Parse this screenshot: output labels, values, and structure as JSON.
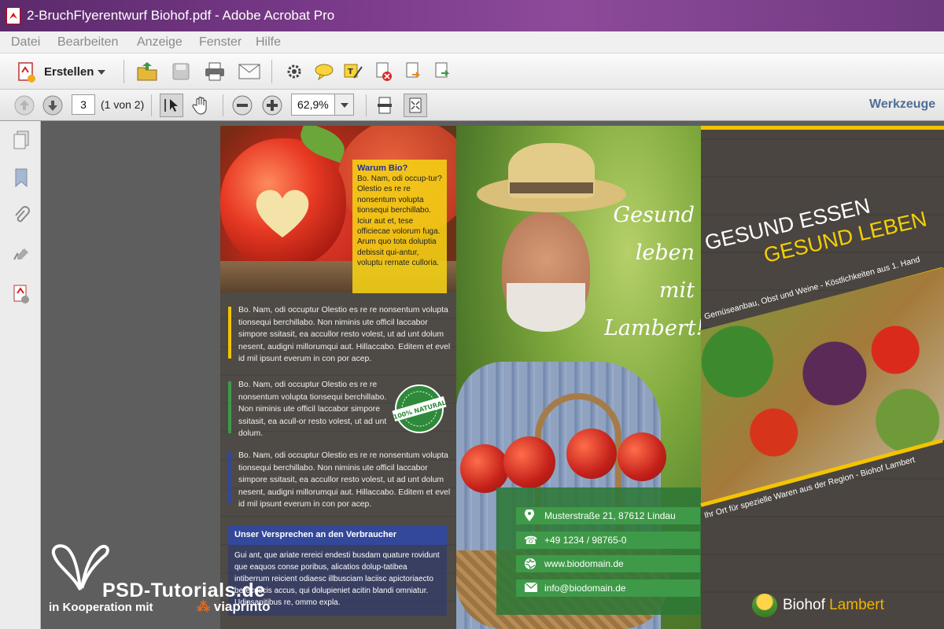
{
  "window": {
    "title": "2-BruchFlyerentwurf Biohof.pdf - Adobe Acrobat Pro"
  },
  "menu": [
    "Datei",
    "Bearbeiten",
    "Anzeige",
    "Fenster",
    "Hilfe"
  ],
  "toolbar": {
    "create_label": "Erstellen",
    "icons": [
      "open-icon",
      "save-icon",
      "print-icon",
      "email-icon",
      "settings-icon",
      "comment-icon",
      "sign-icon",
      "delete-page-icon",
      "export-icon",
      "share-icon"
    ]
  },
  "navigation": {
    "current_page": "3",
    "page_count": "(1 von 2)",
    "zoom": "62,9%",
    "tools_label": "Werkzeuge"
  },
  "side_panel": [
    "pages-icon",
    "bookmark-icon",
    "attachment-icon",
    "signature-icon",
    "document-properties-icon"
  ],
  "flyer": {
    "warum": {
      "title": "Warum Bio?",
      "text": "Bo. Nam, odi occup-tur? Olestio es re re nonsentum volupta tionsequi berchillabo. Iciur aut et, tese officiecae volorum fuga. Arum quo tota doluptia debissit qui-antur, voluptu rernate culloria."
    },
    "block1": "Bo. Nam, odi occuptur Olestio es re re nonsentum volupta tionsequi berchillabo. Non niminis ute officil laccabor simpore ssitasit, ea accullor resto volest, ut ad unt dolum nesent, audigni millorumqui aut. Hillaccabo. Editem et evel id mil ipsunt everum in con por acep.",
    "block2": "Bo. Nam, odi occuptur Olestio es re re nonsentum volupta tionsequi berchillabo. Non niminis ute officil laccabor simpore ssitasit, ea acull-or resto volest, ut ad unt dolum.",
    "block3": "Bo. Nam, odi occuptur Olestio es re re nonsentum volupta tionsequi berchillabo. Non niminis ute officil laccabor simpore ssitasit, ea accullor resto volest, ut ad unt dolum nesent, audigni millorumqui aut. Hillaccabo. Editem et evel id mil ipsunt everum in con por acep.",
    "badge_text": "100% NATURAL",
    "promise_title": "Unser Versprechen an den Verbraucher",
    "promise_text": "Gui ant, que ariate rereici endesti busdam quature rovidunt que eaquos conse poribus, alicatios dolup-tatibea intiberrum reicient odiaesc illbusciam laciisc apictoriaecto berecuscis accus, qui dolupieniet acitin blandi omniatur. Udipsanitibus re, ommo expla.",
    "slogan": [
      "Gesund",
      "leben mit",
      "Lambert!"
    ],
    "contact": {
      "address": "Musterstraße 21, 87612 Lindau",
      "phone": "+49 1234 / 98765-0",
      "web": "www.biodomain.de",
      "email": "info@biodomain.de"
    },
    "headline1": "GESUND ESSEN",
    "headline2": "GESUND LEBEN",
    "tagline_top": "Gemüseanbau, Obst und Weine - Köstlichkeiten aus 1. Hand",
    "tagline_bottom": "Ihr Ort für spezielle Waren aus der Region - Biohof Lambert",
    "logo_name": "Biohof",
    "logo_accent": "Lambert"
  },
  "watermark": {
    "title": "PSD-Tutorials.de",
    "subtitle": "in Kooperation mit",
    "brand": "viaprinto"
  },
  "colors": {
    "accent_yellow": "#f4c400",
    "accent_green": "#3e9a48",
    "accent_blue": "#33489a",
    "titlebar": "#7a3a8a"
  }
}
